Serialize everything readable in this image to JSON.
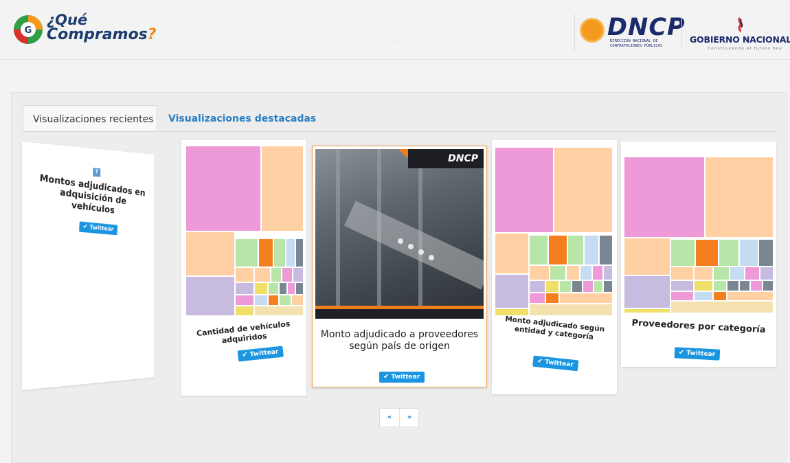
{
  "header": {
    "logo_line1": "¿Qué",
    "logo_line2_pre": "Compram",
    "logo_line2_o": "os",
    "logo_line2_q": "?",
    "dncp_word": "DNCP",
    "dncp_sub1": "DIRECCIÓN NACIONAL DE",
    "dncp_sub2": "CONTRATACIONES PÚBLICAS",
    "gob_word_left": "GOBIERNO",
    "gob_word_right": "NACIONAL",
    "gob_sub": "Construyendo el futuro hoy",
    "carousel_dots": "○○○"
  },
  "tabs": [
    {
      "label": "Visualizaciones recientes",
      "active": true
    },
    {
      "label": "Visualizaciones destacadas",
      "active": false
    }
  ],
  "cards": {
    "far_left": {
      "title": "Montos adjudicados en adquisición de vehículos",
      "twitter": "Twittear",
      "help_icon": "?"
    },
    "left": {
      "title": "Cantidad de vehículos adquiridos",
      "twitter": "Twittear"
    },
    "center": {
      "title": "Monto adjudicado a proveedores según país de origen",
      "twitter": "Twittear",
      "photo_brand": "DNCP"
    },
    "right": {
      "title": "Monto adjudicado según entidad y categoría",
      "twitter": "Twittear"
    },
    "far_right": {
      "title": "Proveedores por categoría",
      "twitter": "Twittear"
    }
  },
  "pager": {
    "prev": "«",
    "next": "»"
  },
  "colors": {
    "brand_blue": "#1c3d6e",
    "accent_orange": "#f08a1c",
    "link_blue": "#2a7fc4",
    "twitter_blue": "#1b95e0",
    "treemap_pink": "#ee99d8",
    "treemap_peach": "#ffd0a3",
    "treemap_lavender": "#c7bce0"
  }
}
